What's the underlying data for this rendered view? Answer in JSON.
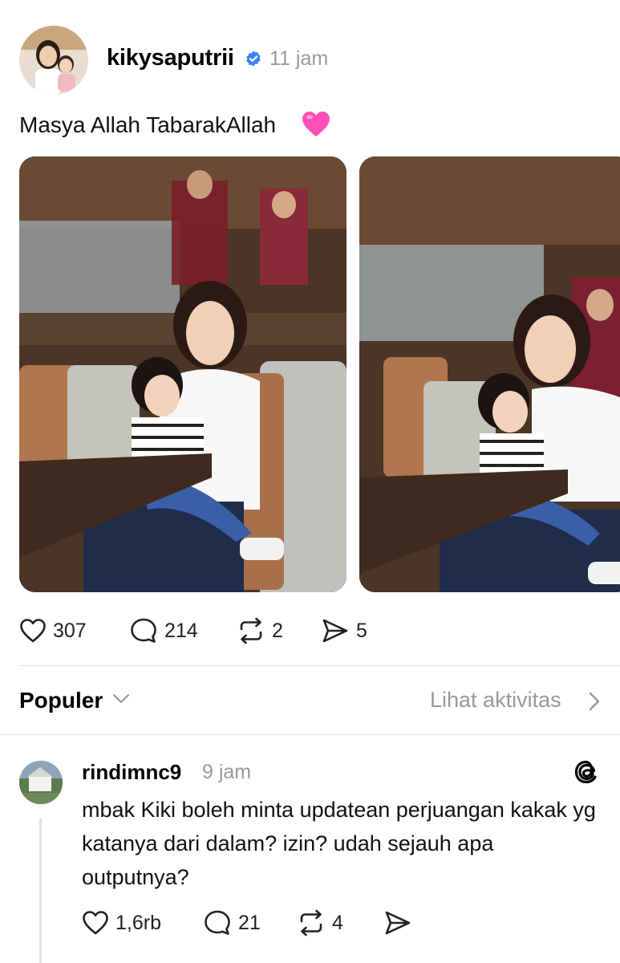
{
  "post": {
    "username": "kikysaputrii",
    "time": "11 jam",
    "caption": "Masya Allah TabarakAllah",
    "stats": {
      "likes": "307",
      "comments": "214",
      "reposts": "2",
      "shares": "5"
    }
  },
  "replies_header": {
    "sort_label": "Populer",
    "activity_label": "Lihat aktivitas"
  },
  "reply": {
    "username": "rindimnc9",
    "time": "9 jam",
    "text": "mbak Kiki boleh minta updatean perjuangan kakak yg katanya dari dalam? izin? udah sejauh apa outputnya?",
    "stats": {
      "likes": "1,6rb",
      "comments": "21",
      "reposts": "4"
    }
  },
  "colors": {
    "verified": "#3b82f6",
    "muted_text": "#999999",
    "divider": "#e4e4e4",
    "heart_emoji": "#ff4fb8"
  }
}
